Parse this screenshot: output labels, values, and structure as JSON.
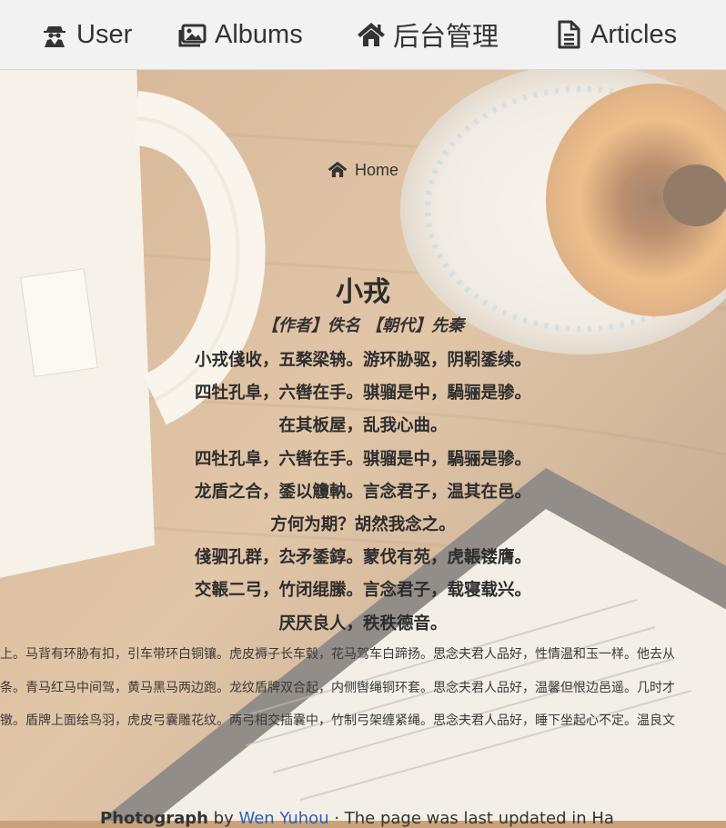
{
  "nav": {
    "items": [
      {
        "label": "User",
        "icon": "user-secret-icon"
      },
      {
        "label": "Albums",
        "icon": "images-icon"
      },
      {
        "label": "后台管理",
        "icon": "home-icon"
      },
      {
        "label": "Articles",
        "icon": "file-text-icon"
      }
    ]
  },
  "breadcrumb": {
    "home": "Home",
    "icon": "home-icon"
  },
  "poem": {
    "title": "小戎",
    "meta": "【作者】佚名 【朝代】先秦",
    "lines": [
      "小戎俴收，五楘梁辀。游环胁驱，阴靷鋈续。",
      "四牡孔阜，六辔在手。骐骝是中，騧骊是骖。",
      "在其板屋，乱我心曲。",
      "四牡孔阜，六辔在手。骐骝是中，騧骊是骖。",
      "龙盾之合，鋈以觼軜。言念君子，温其在邑。",
      "方何为期？胡然我念之。",
      "俴驷孔群，厹矛鋈錞。蒙伐有苑，虎韔镂膺。",
      "交韔二弓，竹闭绲縢。言念君子，载寝载兴。",
      "厌厌良人，秩秩德音。"
    ],
    "translation": [
      "辕上。马背有环胁有扣，引车带环白铜镶。虎皮褥子长车毂，花马驾车白蹄扬。思念夫君人品好，性情温和玉一样。他去从",
      "六条。青马红马中间驾，黄马黑马两边跑。龙纹盾牌双合起，内侧辔绳铜环套。思念夫君人品好，温馨但恨边邑遥。几时才",
      "铜镦。盾牌上面绘鸟羽，虎皮弓囊雕花纹。两弓相交插囊中，竹制弓架缠紧绳。思念夫君人品好，睡下坐起心不定。温良文"
    ]
  },
  "footer": {
    "strong": "Photograph",
    "sep": " by ",
    "link": "Wen Yuhou",
    "rest": " · The page was last updated in Ha"
  },
  "colors": {
    "nav_bg": "#f2f2f2",
    "text": "#2d2d2d",
    "link": "#2b5fb8"
  }
}
